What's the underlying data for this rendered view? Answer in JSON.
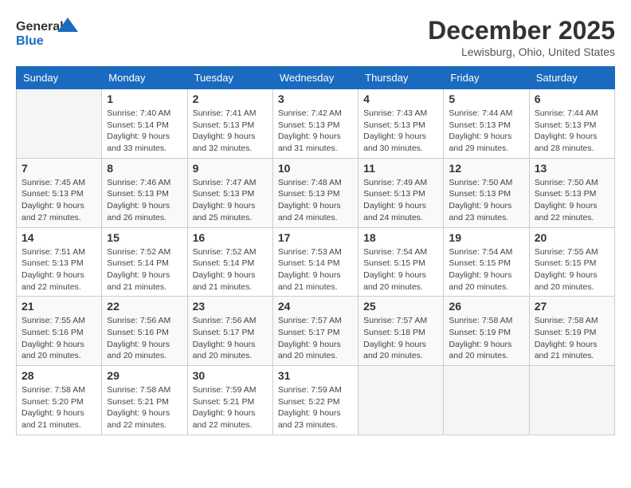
{
  "logo": {
    "line1": "General",
    "line2": "Blue"
  },
  "title": "December 2025",
  "location": "Lewisburg, Ohio, United States",
  "weekdays": [
    "Sunday",
    "Monday",
    "Tuesday",
    "Wednesday",
    "Thursday",
    "Friday",
    "Saturday"
  ],
  "weeks": [
    [
      {
        "day": "",
        "sunrise": "",
        "sunset": "",
        "daylight": ""
      },
      {
        "day": "1",
        "sunrise": "Sunrise: 7:40 AM",
        "sunset": "Sunset: 5:14 PM",
        "daylight": "Daylight: 9 hours and 33 minutes."
      },
      {
        "day": "2",
        "sunrise": "Sunrise: 7:41 AM",
        "sunset": "Sunset: 5:13 PM",
        "daylight": "Daylight: 9 hours and 32 minutes."
      },
      {
        "day": "3",
        "sunrise": "Sunrise: 7:42 AM",
        "sunset": "Sunset: 5:13 PM",
        "daylight": "Daylight: 9 hours and 31 minutes."
      },
      {
        "day": "4",
        "sunrise": "Sunrise: 7:43 AM",
        "sunset": "Sunset: 5:13 PM",
        "daylight": "Daylight: 9 hours and 30 minutes."
      },
      {
        "day": "5",
        "sunrise": "Sunrise: 7:44 AM",
        "sunset": "Sunset: 5:13 PM",
        "daylight": "Daylight: 9 hours and 29 minutes."
      },
      {
        "day": "6",
        "sunrise": "Sunrise: 7:44 AM",
        "sunset": "Sunset: 5:13 PM",
        "daylight": "Daylight: 9 hours and 28 minutes."
      }
    ],
    [
      {
        "day": "7",
        "sunrise": "Sunrise: 7:45 AM",
        "sunset": "Sunset: 5:13 PM",
        "daylight": "Daylight: 9 hours and 27 minutes."
      },
      {
        "day": "8",
        "sunrise": "Sunrise: 7:46 AM",
        "sunset": "Sunset: 5:13 PM",
        "daylight": "Daylight: 9 hours and 26 minutes."
      },
      {
        "day": "9",
        "sunrise": "Sunrise: 7:47 AM",
        "sunset": "Sunset: 5:13 PM",
        "daylight": "Daylight: 9 hours and 25 minutes."
      },
      {
        "day": "10",
        "sunrise": "Sunrise: 7:48 AM",
        "sunset": "Sunset: 5:13 PM",
        "daylight": "Daylight: 9 hours and 24 minutes."
      },
      {
        "day": "11",
        "sunrise": "Sunrise: 7:49 AM",
        "sunset": "Sunset: 5:13 PM",
        "daylight": "Daylight: 9 hours and 24 minutes."
      },
      {
        "day": "12",
        "sunrise": "Sunrise: 7:50 AM",
        "sunset": "Sunset: 5:13 PM",
        "daylight": "Daylight: 9 hours and 23 minutes."
      },
      {
        "day": "13",
        "sunrise": "Sunrise: 7:50 AM",
        "sunset": "Sunset: 5:13 PM",
        "daylight": "Daylight: 9 hours and 22 minutes."
      }
    ],
    [
      {
        "day": "14",
        "sunrise": "Sunrise: 7:51 AM",
        "sunset": "Sunset: 5:13 PM",
        "daylight": "Daylight: 9 hours and 22 minutes."
      },
      {
        "day": "15",
        "sunrise": "Sunrise: 7:52 AM",
        "sunset": "Sunset: 5:14 PM",
        "daylight": "Daylight: 9 hours and 21 minutes."
      },
      {
        "day": "16",
        "sunrise": "Sunrise: 7:52 AM",
        "sunset": "Sunset: 5:14 PM",
        "daylight": "Daylight: 9 hours and 21 minutes."
      },
      {
        "day": "17",
        "sunrise": "Sunrise: 7:53 AM",
        "sunset": "Sunset: 5:14 PM",
        "daylight": "Daylight: 9 hours and 21 minutes."
      },
      {
        "day": "18",
        "sunrise": "Sunrise: 7:54 AM",
        "sunset": "Sunset: 5:15 PM",
        "daylight": "Daylight: 9 hours and 20 minutes."
      },
      {
        "day": "19",
        "sunrise": "Sunrise: 7:54 AM",
        "sunset": "Sunset: 5:15 PM",
        "daylight": "Daylight: 9 hours and 20 minutes."
      },
      {
        "day": "20",
        "sunrise": "Sunrise: 7:55 AM",
        "sunset": "Sunset: 5:15 PM",
        "daylight": "Daylight: 9 hours and 20 minutes."
      }
    ],
    [
      {
        "day": "21",
        "sunrise": "Sunrise: 7:55 AM",
        "sunset": "Sunset: 5:16 PM",
        "daylight": "Daylight: 9 hours and 20 minutes."
      },
      {
        "day": "22",
        "sunrise": "Sunrise: 7:56 AM",
        "sunset": "Sunset: 5:16 PM",
        "daylight": "Daylight: 9 hours and 20 minutes."
      },
      {
        "day": "23",
        "sunrise": "Sunrise: 7:56 AM",
        "sunset": "Sunset: 5:17 PM",
        "daylight": "Daylight: 9 hours and 20 minutes."
      },
      {
        "day": "24",
        "sunrise": "Sunrise: 7:57 AM",
        "sunset": "Sunset: 5:17 PM",
        "daylight": "Daylight: 9 hours and 20 minutes."
      },
      {
        "day": "25",
        "sunrise": "Sunrise: 7:57 AM",
        "sunset": "Sunset: 5:18 PM",
        "daylight": "Daylight: 9 hours and 20 minutes."
      },
      {
        "day": "26",
        "sunrise": "Sunrise: 7:58 AM",
        "sunset": "Sunset: 5:19 PM",
        "daylight": "Daylight: 9 hours and 20 minutes."
      },
      {
        "day": "27",
        "sunrise": "Sunrise: 7:58 AM",
        "sunset": "Sunset: 5:19 PM",
        "daylight": "Daylight: 9 hours and 21 minutes."
      }
    ],
    [
      {
        "day": "28",
        "sunrise": "Sunrise: 7:58 AM",
        "sunset": "Sunset: 5:20 PM",
        "daylight": "Daylight: 9 hours and 21 minutes."
      },
      {
        "day": "29",
        "sunrise": "Sunrise: 7:58 AM",
        "sunset": "Sunset: 5:21 PM",
        "daylight": "Daylight: 9 hours and 22 minutes."
      },
      {
        "day": "30",
        "sunrise": "Sunrise: 7:59 AM",
        "sunset": "Sunset: 5:21 PM",
        "daylight": "Daylight: 9 hours and 22 minutes."
      },
      {
        "day": "31",
        "sunrise": "Sunrise: 7:59 AM",
        "sunset": "Sunset: 5:22 PM",
        "daylight": "Daylight: 9 hours and 23 minutes."
      },
      {
        "day": "",
        "sunrise": "",
        "sunset": "",
        "daylight": ""
      },
      {
        "day": "",
        "sunrise": "",
        "sunset": "",
        "daylight": ""
      },
      {
        "day": "",
        "sunrise": "",
        "sunset": "",
        "daylight": ""
      }
    ]
  ]
}
